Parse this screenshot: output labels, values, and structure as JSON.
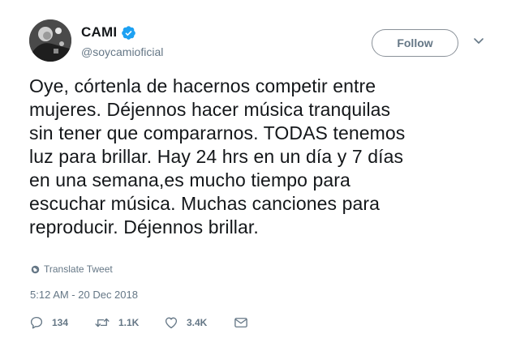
{
  "author": {
    "display_name": "CAMI",
    "handle": "@soycamioficial",
    "verified": true
  },
  "header": {
    "follow_label": "Follow"
  },
  "tweet": {
    "lines": [
      "Oye, córtenla de hacernos competir entre",
      "mujeres. Déjennos hacer música tranquilas",
      "sin tener que compararnos. TODAS tenemos",
      "luz para brillar. Hay 24 hrs en un día y 7 días",
      "en una semana,es mucho tiempo para",
      "escuchar música. Muchas canciones para",
      "reproducir. Déjennos brillar."
    ],
    "translate_label": "Translate Tweet",
    "timestamp": "5:12 AM - 20 Dec 2018"
  },
  "actions": {
    "replies": "134",
    "retweets": "1.1K",
    "likes": "3.4K"
  },
  "colors": {
    "verified_blue": "#1da1f2",
    "muted_text": "#657786",
    "primary_text": "#14171a"
  }
}
